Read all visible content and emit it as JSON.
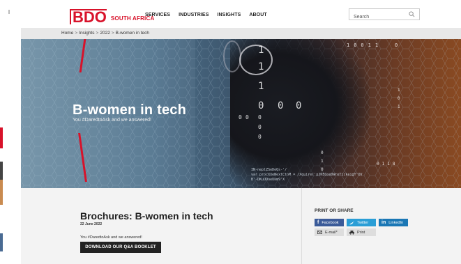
{
  "header": {
    "logo_main": "BDO",
    "logo_region": "SOUTH AFRICA",
    "nav": [
      "SERVICES",
      "INDUSTRIES",
      "INSIGHTS",
      "ABOUT"
    ],
    "search_placeholder": "Search"
  },
  "breadcrumb": [
    "Home",
    "Insights",
    "2022",
    "B-women in tech"
  ],
  "hero": {
    "title": "B-women in tech",
    "subtitle": "You #DaredtoAsk and we answered!",
    "code_lines": [
      "IN-neplZSeDeQs-'/",
      "var procXXeNextCtoM = /Xquire('pJKEQoeDWreTickeigY'OV",
      "B'-DKuUDoeUkm9'X"
    ]
  },
  "brochure": {
    "title": "Brochures: B-women in tech",
    "date": "22 June 2022",
    "body": "You #DaredtoAsk and we answered!",
    "button": "DOWNLOAD OUR Q&A BOOKLET"
  },
  "share": {
    "title": "PRINT OR SHARE",
    "facebook": "Facebook",
    "twitter": "Twitter",
    "linkedin": "LinkedIn",
    "email": "E-mail*",
    "print": "Print"
  },
  "colors": {
    "brand_red": "#d8122a",
    "facebook": "#3b5b99",
    "twitter": "#2a9ed6",
    "linkedin": "#1a77b5"
  },
  "icons": [
    "search-icon",
    "facebook-icon",
    "twitter-icon",
    "linkedin-icon",
    "email-icon",
    "print-icon"
  ]
}
